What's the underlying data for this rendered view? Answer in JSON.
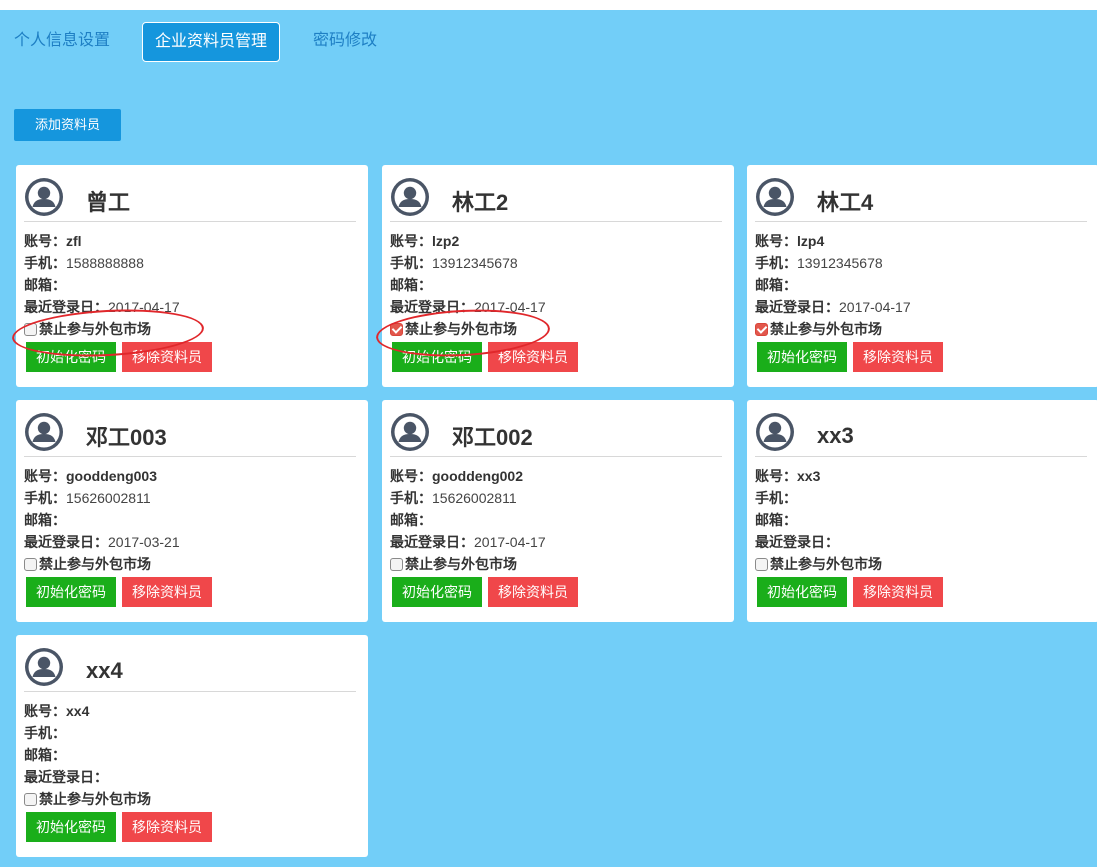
{
  "colors": {
    "page_bg": "#72cef8",
    "tab_active_bg": "#1596dd",
    "tab_text": "#1e7fc4",
    "btn_green": "#1aae1a",
    "btn_red": "#f0474a",
    "annotation_ring": "#e0272b"
  },
  "tabs": [
    {
      "label": "个人信息设置",
      "active": false
    },
    {
      "label": "企业资料员管理",
      "active": true
    },
    {
      "label": "密码修改",
      "active": false
    }
  ],
  "add_button_label": "添加资料员",
  "labels": {
    "account": "账号：",
    "phone": "手机：",
    "email": "邮箱：",
    "last_login": "最近登录日：",
    "ban_market": "禁止参与外包市场",
    "reset_password": "初始化密码",
    "remove": "移除资料员"
  },
  "icons": {
    "avatar": "user-avatar-icon",
    "checkbox": "checkbox-icon"
  },
  "cards": [
    {
      "name": "曾工",
      "account": "zfl",
      "phone": "1588888888",
      "email": "",
      "last_login": "2017-04-17",
      "ban_market": false
    },
    {
      "name": "林工2",
      "account": "lzp2",
      "phone": "13912345678",
      "email": "",
      "last_login": "2017-04-17",
      "ban_market": true
    },
    {
      "name": "林工4",
      "account": "lzp4",
      "phone": "13912345678",
      "email": "",
      "last_login": "2017-04-17",
      "ban_market": true
    },
    {
      "name": "邓工003",
      "account": "gooddeng003",
      "phone": "15626002811",
      "email": "",
      "last_login": "2017-03-21",
      "ban_market": false
    },
    {
      "name": "邓工002",
      "account": "gooddeng002",
      "phone": "15626002811",
      "email": "",
      "last_login": "2017-04-17",
      "ban_market": false
    },
    {
      "name": "xx3",
      "account": "xx3",
      "phone": "",
      "email": "",
      "last_login": "",
      "ban_market": false
    },
    {
      "name": "xx4",
      "account": "xx4",
      "phone": "",
      "email": "",
      "last_login": "",
      "ban_market": false
    }
  ]
}
